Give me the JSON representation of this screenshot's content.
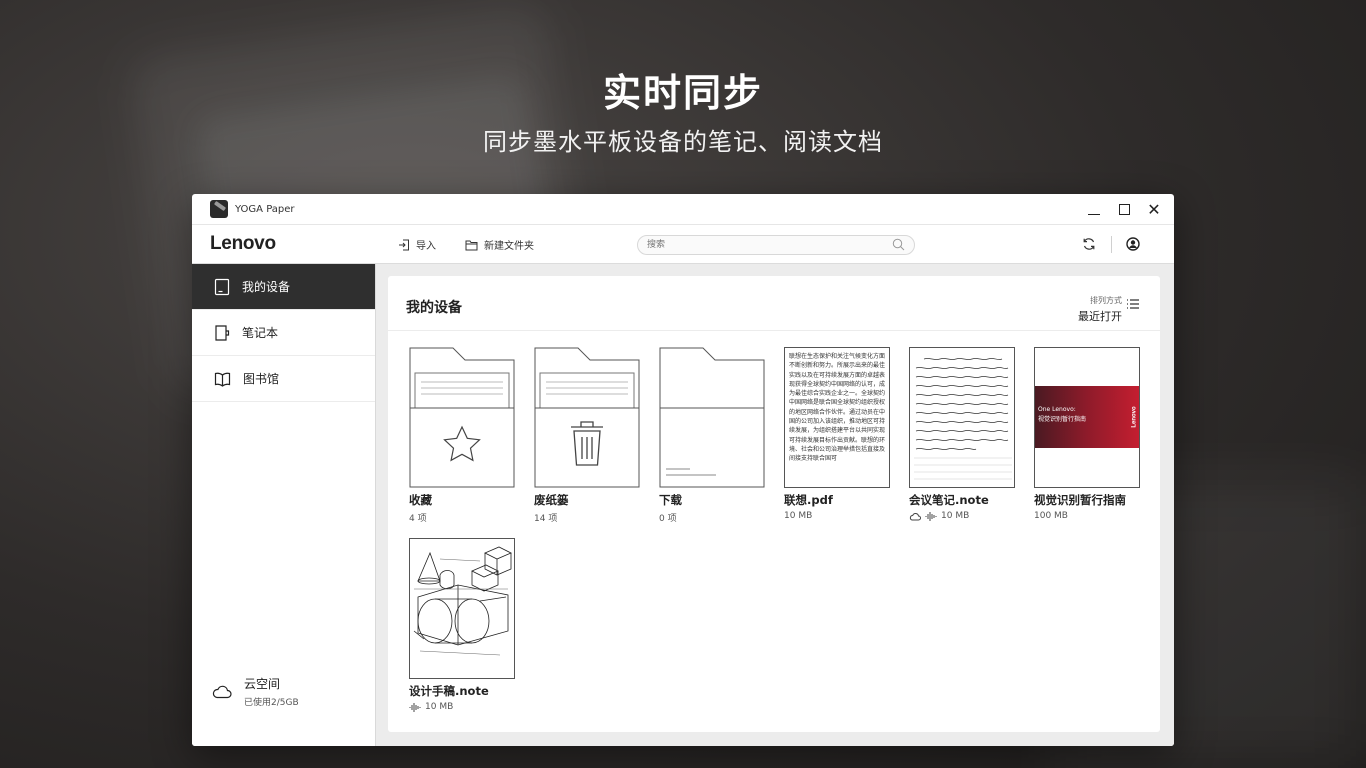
{
  "hero": {
    "title": "实时同步",
    "subtitle": "同步墨水平板设备的笔记、阅读文档"
  },
  "window": {
    "app_title": "YOGA Paper",
    "brand": "Lenovo"
  },
  "toolbar": {
    "import_label": "导入",
    "new_folder_label": "新建文件夹",
    "search_placeholder": "搜索"
  },
  "sidebar": {
    "items": [
      {
        "label": "我的设备",
        "icon": "tablet-icon",
        "active": true
      },
      {
        "label": "笔记本",
        "icon": "notebook-icon",
        "active": false
      },
      {
        "label": "图书馆",
        "icon": "book-icon",
        "active": false
      }
    ],
    "cloud": {
      "label": "云空间",
      "usage": "已使用2/5GB",
      "icon": "cloud-icon"
    }
  },
  "main": {
    "title": "我的设备",
    "sort_caption": "排列方式",
    "sort_value": "最近打开",
    "files": [
      {
        "name": "收藏",
        "meta": "4 项",
        "kind": "folder",
        "icon": "star-icon"
      },
      {
        "name": "废纸篓",
        "meta": "14 项",
        "kind": "folder",
        "icon": "trash-icon"
      },
      {
        "name": "下载",
        "meta": "0 项",
        "kind": "folder",
        "icon": "download-folder"
      },
      {
        "name": "联想.pdf",
        "meta": "10 MB",
        "kind": "pdf"
      },
      {
        "name": "会议笔记.note",
        "meta": "10 MB",
        "kind": "note"
      },
      {
        "name": "视觉识别暂行指南",
        "meta": "100 MB",
        "kind": "cover"
      },
      {
        "name": "设计手稿.note",
        "meta": "10 MB",
        "kind": "sketch"
      }
    ],
    "pdf_preview_text": "联想在生态保护和关注气候变化方面不断创新和努力。所展示出来的最佳实践以及在可持续发展方面的卓越表现获得全球契约中国网络的认可，成为最佳综合实践企业之一。全球契约中国网络是联合国全球契约组织授权的地区网络合作伙伴。通过动员在中国的公司加入该组织，推动地区可持续发展，为组织搭建平台以共同实现可持续发展目标作出贡献。联想的环境、社会和公司治理举措包括直接及间接支持联合国可",
    "cover_line1": "One Lenovo:",
    "cover_line2": "视觉识别暂行指南",
    "cover_brand": "Lenovo"
  },
  "colors": {
    "active_nav_bg": "#2f2f2f",
    "cover_red": "#c41e30",
    "content_bg": "#ececec"
  }
}
